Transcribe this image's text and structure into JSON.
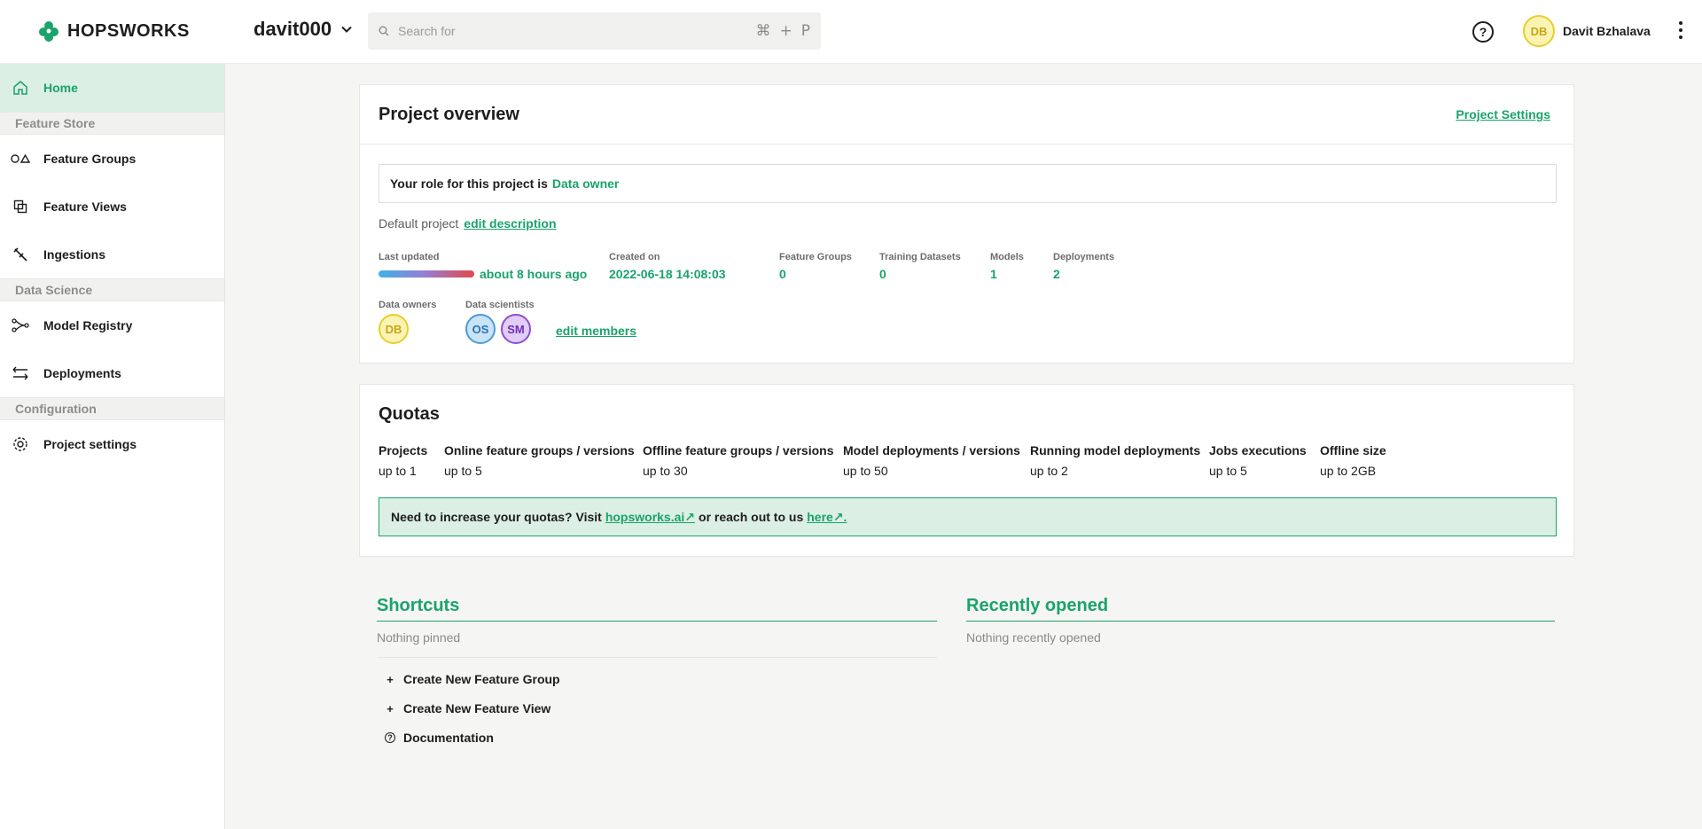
{
  "header": {
    "brand": "HOPSWORKS",
    "project": "davit000",
    "search_placeholder": "Search for",
    "shortcut_keys": [
      "⌘",
      "+",
      "P"
    ],
    "help": "?",
    "user_initials": "DB",
    "user_name": "Davit Bzhalava"
  },
  "sidebar": {
    "home": "Home",
    "feature_store": "Feature Store",
    "feature_groups": "Feature Groups",
    "feature_views": "Feature Views",
    "ingestions": "Ingestions",
    "data_science": "Data Science",
    "model_registry": "Model Registry",
    "deployments": "Deployments",
    "configuration": "Configuration",
    "project_settings": "Project settings"
  },
  "overview": {
    "title": "Project overview",
    "settings_link": "Project Settings",
    "role_prefix": "Your role for this project is",
    "role": "Data owner",
    "description": "Default project",
    "edit_description": "edit description",
    "stats": {
      "last_updated_label": "Last updated",
      "last_updated_value": "about 8 hours ago",
      "created_label": "Created on",
      "created_value": "2022-06-18 14:08:03",
      "feature_groups_label": "Feature Groups",
      "feature_groups_value": "0",
      "training_label": "Training Datasets",
      "training_value": "0",
      "models_label": "Models",
      "models_value": "1",
      "deployments_label": "Deployments",
      "deployments_value": "2"
    },
    "owners_label": "Data owners",
    "owners": [
      "DB"
    ],
    "scientists_label": "Data scientists",
    "scientists": [
      "OS",
      "SM"
    ],
    "edit_members": "edit members"
  },
  "quotas": {
    "title": "Quotas",
    "items": [
      {
        "label": "Projects",
        "value": "up to 1"
      },
      {
        "label": "Online feature groups / versions",
        "value": "up to 5"
      },
      {
        "label": "Offline feature groups / versions",
        "value": "up to 30"
      },
      {
        "label": "Model deployments / versions",
        "value": "up to 50"
      },
      {
        "label": "Running model deployments",
        "value": "up to 2"
      },
      {
        "label": "Jobs executions",
        "value": "up to 5"
      },
      {
        "label": "Offline size",
        "value": "up to 2GB"
      }
    ],
    "banner_text": "Need to increase your quotas? Visit",
    "banner_link1": "hopsworks.ai↗",
    "banner_mid": "or reach out to us",
    "banner_link2": "here↗."
  },
  "shortcuts": {
    "title": "Shortcuts",
    "empty": "Nothing pinned",
    "items": [
      {
        "icon": "+",
        "label": "Create New Feature Group"
      },
      {
        "icon": "+",
        "label": "Create New Feature View"
      },
      {
        "icon": "?",
        "label": "Documentation"
      }
    ]
  },
  "recent": {
    "title": "Recently opened",
    "empty": "Nothing recently opened"
  },
  "colors": {
    "accent": "#1aa36b",
    "active_bg": "#dcefe4"
  }
}
